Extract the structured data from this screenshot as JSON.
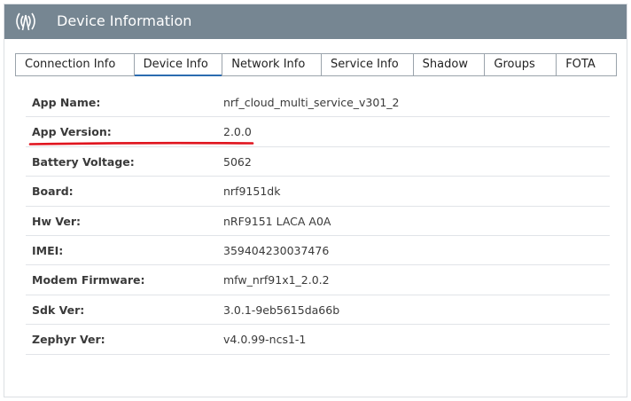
{
  "header": {
    "title": "Device Information",
    "icon": "signal-waves-icon",
    "background": "#768692"
  },
  "tabs": [
    {
      "label": "Connection Info",
      "active": false
    },
    {
      "label": "Device Info",
      "active": true
    },
    {
      "label": "Network Info",
      "active": false
    },
    {
      "label": "Service Info",
      "active": false
    },
    {
      "label": "Shadow",
      "active": false
    },
    {
      "label": "Groups",
      "active": false
    },
    {
      "label": "FOTA",
      "active": false
    }
  ],
  "device_info": {
    "rows": [
      {
        "key": "App Name:",
        "value": "nrf_cloud_multi_service_v301_2"
      },
      {
        "key": "App Version:",
        "value": "2.0.0"
      },
      {
        "key": "Battery Voltage:",
        "value": "5062"
      },
      {
        "key": "Board:",
        "value": "nrf9151dk"
      },
      {
        "key": "Hw Ver:",
        "value": "nRF9151 LACA A0A"
      },
      {
        "key": "IMEI:",
        "value": "359404230037476"
      },
      {
        "key": "Modem Firmware:",
        "value": "mfw_nrf91x1_2.0.2"
      },
      {
        "key": "Sdk Ver:",
        "value": "3.0.1-9eb5615da66b"
      },
      {
        "key": "Zephyr Ver:",
        "value": "v4.0.99-ncs1-1"
      }
    ],
    "highlight_color": "#e0141e"
  }
}
